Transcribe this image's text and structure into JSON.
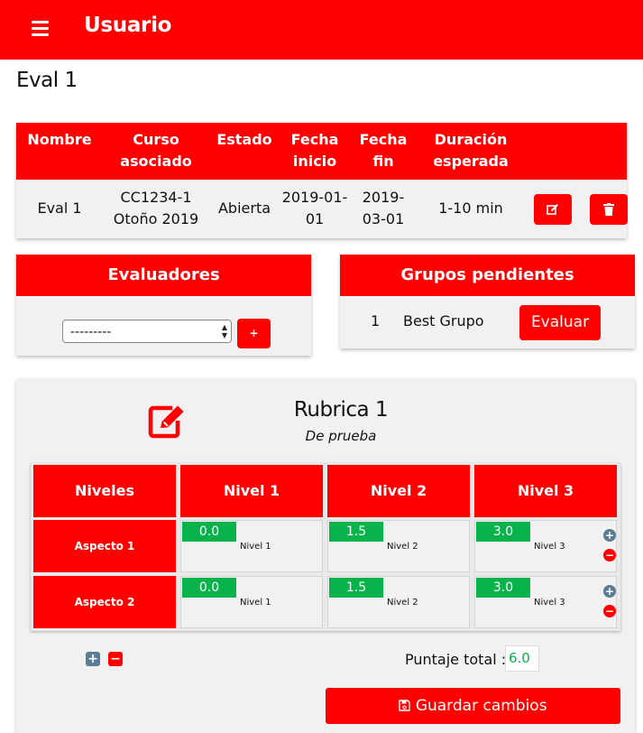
{
  "header": {
    "title": "Usuario",
    "menu_icon": "hamburger-menu-icon",
    "bg_color": "#fe0000"
  },
  "page": {
    "title": "Eval 1"
  },
  "eval_table": {
    "columns": [
      "Nombre",
      "Curso asociado",
      "Estado",
      "Fecha inicio",
      "Fecha fin",
      "Duración esperada"
    ],
    "columns_lines": [
      [
        "Nombre"
      ],
      [
        "Curso",
        "asociado"
      ],
      [
        "Estado"
      ],
      [
        "Fecha",
        "inicio"
      ],
      [
        "Fecha",
        "fin"
      ],
      [
        "Duración",
        "esperada"
      ]
    ],
    "row": {
      "nombre": "Eval 1",
      "curso": [
        "CC1234-1",
        "Otoño 2019"
      ],
      "estado": "Abierta",
      "fecha_inicio": [
        "2019-01-",
        "01"
      ],
      "fecha_fin": [
        "2019-",
        "03-01"
      ],
      "duracion": "1-10 min"
    },
    "actions": [
      "edit-icon",
      "trash-icon"
    ]
  },
  "evaluadores": {
    "title": "Evaluadores",
    "select_value": "---------",
    "add_label": "+"
  },
  "grupos": {
    "title": "Grupos pendientes",
    "items": [
      {
        "num": "1",
        "name": "Best Grupo",
        "action": "Evaluar"
      }
    ]
  },
  "rubrica": {
    "title": "Rubrica 1",
    "subtitle": "De prueba",
    "headers": [
      "Niveles",
      "Nivel 1",
      "Nivel 2",
      "Nivel 3"
    ],
    "rows": [
      {
        "aspect": "Aspecto 1",
        "cells": [
          {
            "score": "0.0",
            "label": "Nivel 1"
          },
          {
            "score": "1.5",
            "label": "Nivel 2"
          },
          {
            "score": "3.0",
            "label": "Nivel 3"
          }
        ]
      },
      {
        "aspect": "Aspecto 2",
        "cells": [
          {
            "score": "0.0",
            "label": "Nivel 1"
          },
          {
            "score": "1.5",
            "label": "Nivel 2"
          },
          {
            "score": "3.0",
            "label": "Nivel 3"
          }
        ]
      }
    ],
    "total_label": "Puntaje total :",
    "total_value": "6.0",
    "save_label": "Guardar cambios",
    "colors": {
      "accent": "#fe0000",
      "score": "#07b34a",
      "add_icon": "#5b7d93"
    }
  }
}
